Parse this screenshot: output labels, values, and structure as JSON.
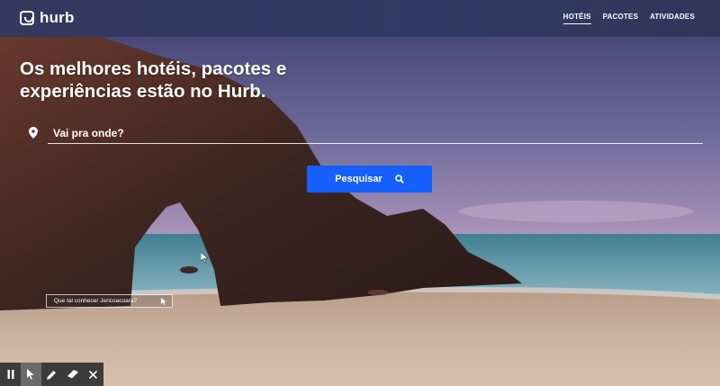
{
  "header": {
    "logo_text": "hurb",
    "nav": [
      {
        "label": "HOTÉIS",
        "active": true
      },
      {
        "label": "PACOTES",
        "active": false
      },
      {
        "label": "ATIVIDADES",
        "active": false
      }
    ]
  },
  "hero": {
    "headline_line1": "Os melhores hotéis, pacotes e",
    "headline_line2": "experiências estão no Hurb."
  },
  "search": {
    "placeholder": "Vai pra onde?",
    "button_label": "Pesquisar"
  },
  "suggestion": {
    "text": "Que tal conhecer Jericoacoara?"
  },
  "toolbar": {
    "items": [
      "pause-icon",
      "pointer-icon",
      "pencil-icon",
      "eraser-icon",
      "close-icon"
    ]
  },
  "colors": {
    "accent": "#1560ff",
    "header_bg": "#33385e",
    "toolbar_bg": "#3b3b3b"
  }
}
